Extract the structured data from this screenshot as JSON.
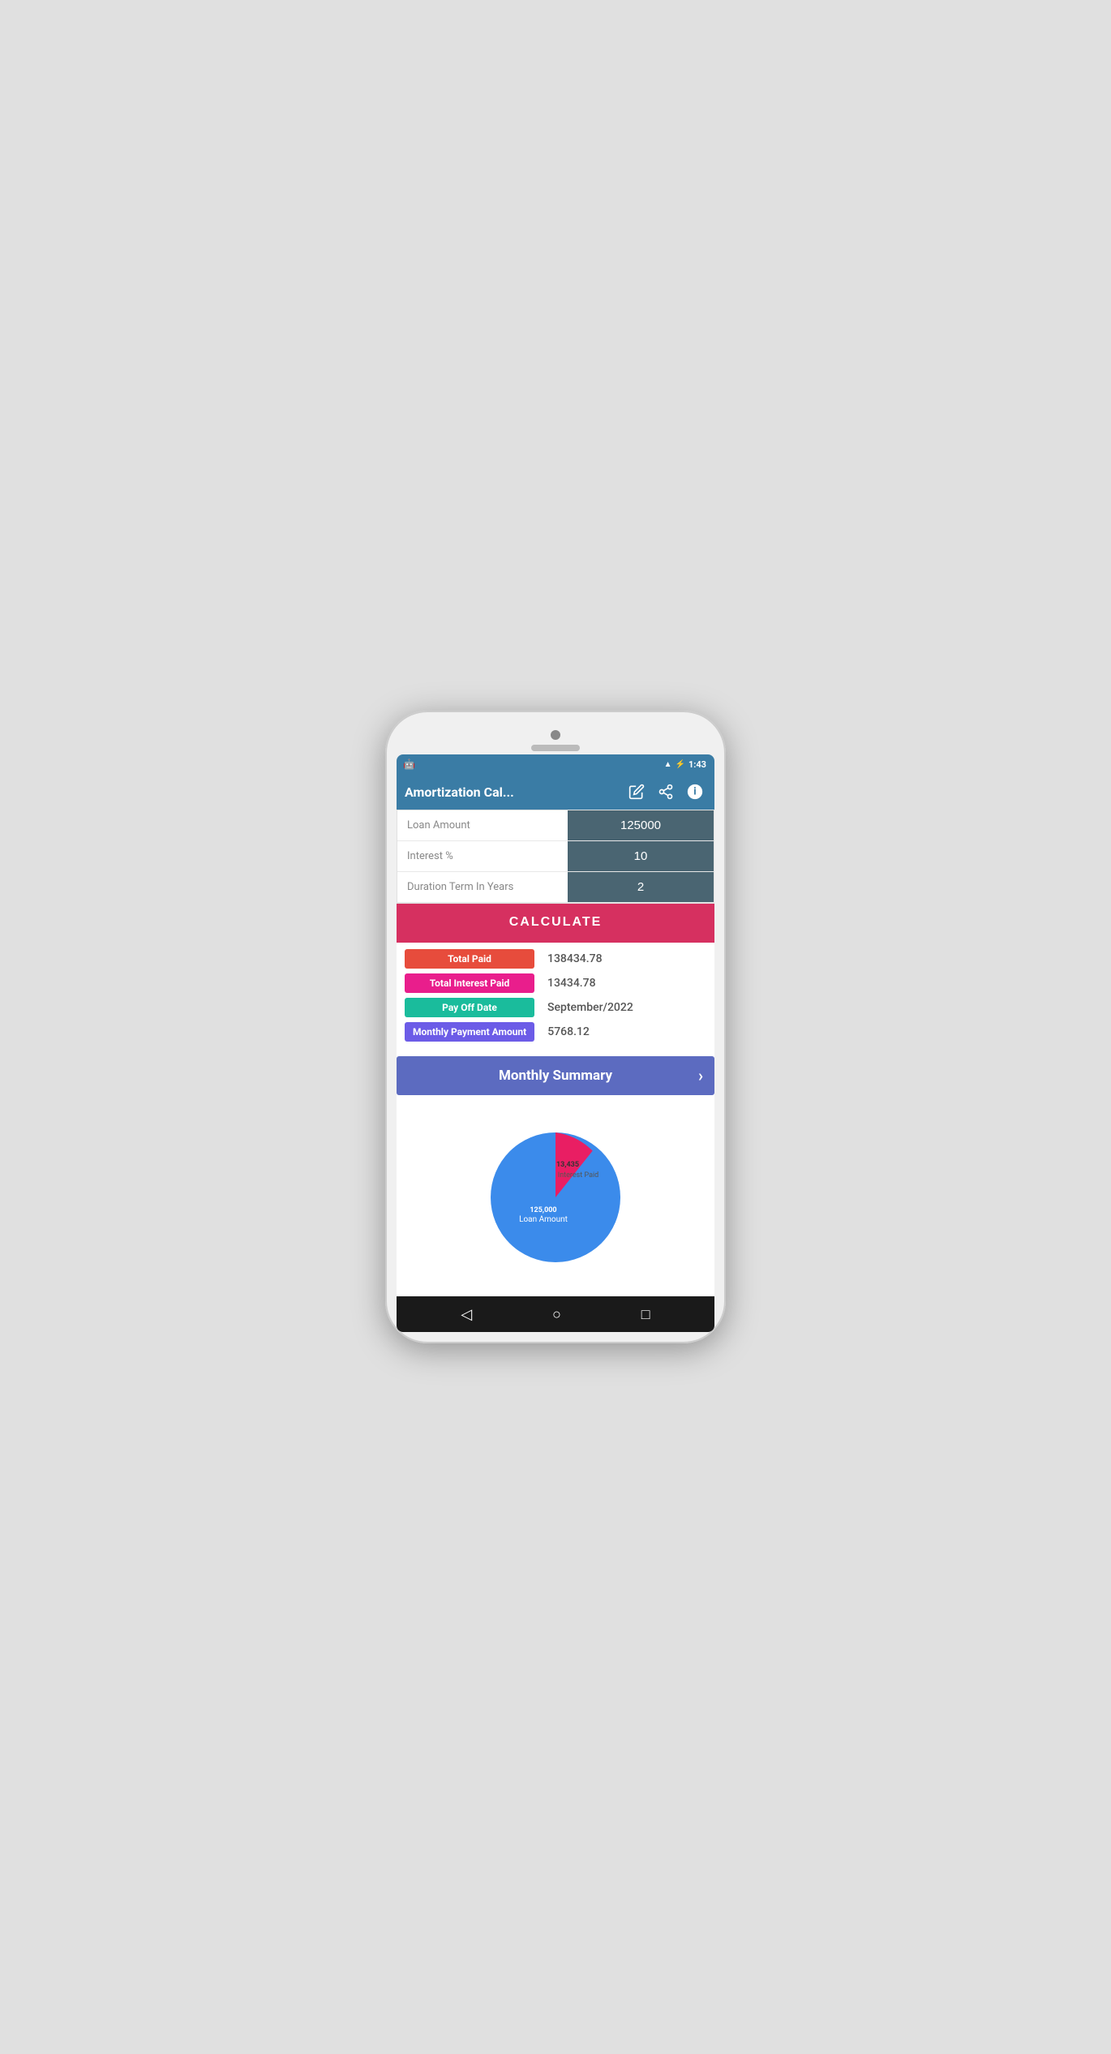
{
  "statusBar": {
    "time": "1:43",
    "batteryIcon": "⚡",
    "signalIcon": "▲"
  },
  "appBar": {
    "title": "Amortization Cal...",
    "editIcon": "✏",
    "shareIcon": "⎘",
    "infoIcon": "ℹ"
  },
  "inputs": {
    "loanAmountLabel": "Loan Amount",
    "loanAmountValue": "125000",
    "interestLabel": "Interest %",
    "interestValue": "10",
    "durationLabel": "Duration Term In Years",
    "durationValue": "2"
  },
  "calculateButton": {
    "label": "CALCULATE"
  },
  "results": {
    "totalPaidLabel": "Total Paid",
    "totalPaidValue": "138434.78",
    "totalInterestLabel": "Total Interest Paid",
    "totalInterestValue": "13434.78",
    "payOffDateLabel": "Pay Off Date",
    "payOffDateValue": "September/2022",
    "monthlyPaymentLabel": "Monthly Payment Amount",
    "monthlyPaymentValue": "5768.12"
  },
  "monthlySummary": {
    "label": "Monthly Summary",
    "chevron": "›"
  },
  "chart": {
    "interestValue": "13,435",
    "interestLabel": "Interest Paid",
    "loanValue": "125,000",
    "loanLabel": "Loan Amount",
    "interestPercent": 9.7,
    "loanPercent": 90.3
  },
  "bottomNav": {
    "backIcon": "◁",
    "homeIcon": "○",
    "recentIcon": "□"
  }
}
